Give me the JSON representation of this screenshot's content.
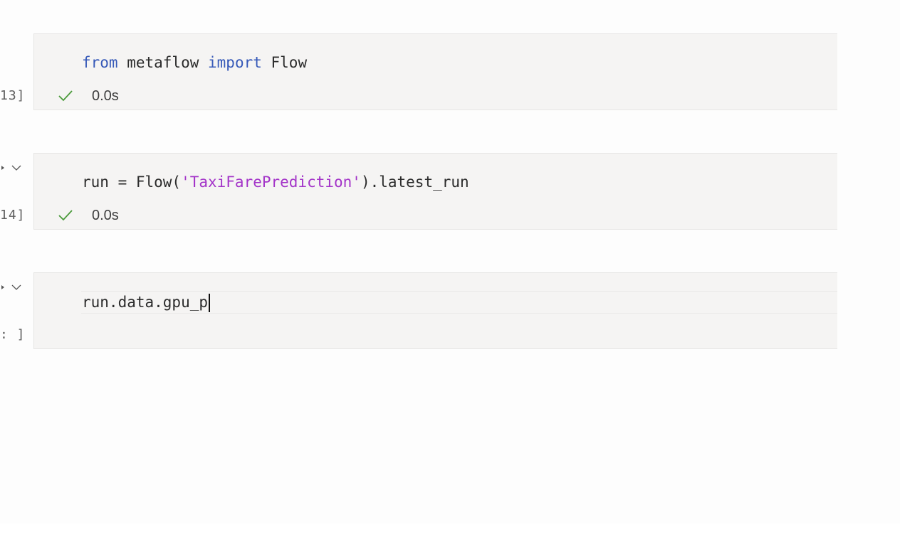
{
  "cells": [
    {
      "exec_count": "13]",
      "code": [
        {
          "text": "from",
          "type": "kw"
        },
        {
          "text": " metaflow ",
          "type": "plain"
        },
        {
          "text": "import",
          "type": "kw"
        },
        {
          "text": " Flow",
          "type": "plain"
        }
      ],
      "status": "success",
      "duration": "0.0s"
    },
    {
      "exec_count": "14]",
      "code": [
        {
          "text": "run = Flow(",
          "type": "plain"
        },
        {
          "text": "'TaxiFarePrediction'",
          "type": "str"
        },
        {
          "text": ").latest_run",
          "type": "plain"
        }
      ],
      "status": "success",
      "duration": "0.0s"
    },
    {
      "exec_count": ": ]",
      "code": [
        {
          "text": "run.data.gpu_p",
          "type": "plain"
        }
      ],
      "status": "editing",
      "duration": ""
    }
  ],
  "icons": {
    "success": "check-icon",
    "collapse": "chevron-down-icon",
    "run": "run-arrow-icon"
  },
  "colors": {
    "keyword": "#3659b8",
    "string": "#a333c8",
    "success": "#4a9a3a",
    "cell_bg": "#f5f4f3"
  }
}
